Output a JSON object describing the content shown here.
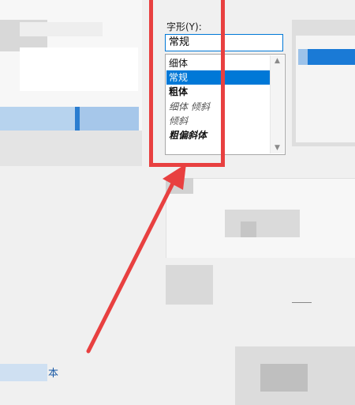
{
  "font_style": {
    "label": "字形(Y):",
    "current_value": "常规",
    "options": [
      {
        "label": "细体",
        "style": "normal"
      },
      {
        "label": "常规",
        "style": "normal",
        "selected": true
      },
      {
        "label": "粗体",
        "style": "bold"
      },
      {
        "label": "细体 倾斜",
        "style": "italic"
      },
      {
        "label": "倾斜",
        "style": "italic"
      },
      {
        "label": "粗偏斜体",
        "style": "bold-italic"
      }
    ]
  },
  "bottom_left_char": "本",
  "colors": {
    "selection": "#0078d7",
    "annotation": "#e84040",
    "background": "#f0f0f0"
  }
}
